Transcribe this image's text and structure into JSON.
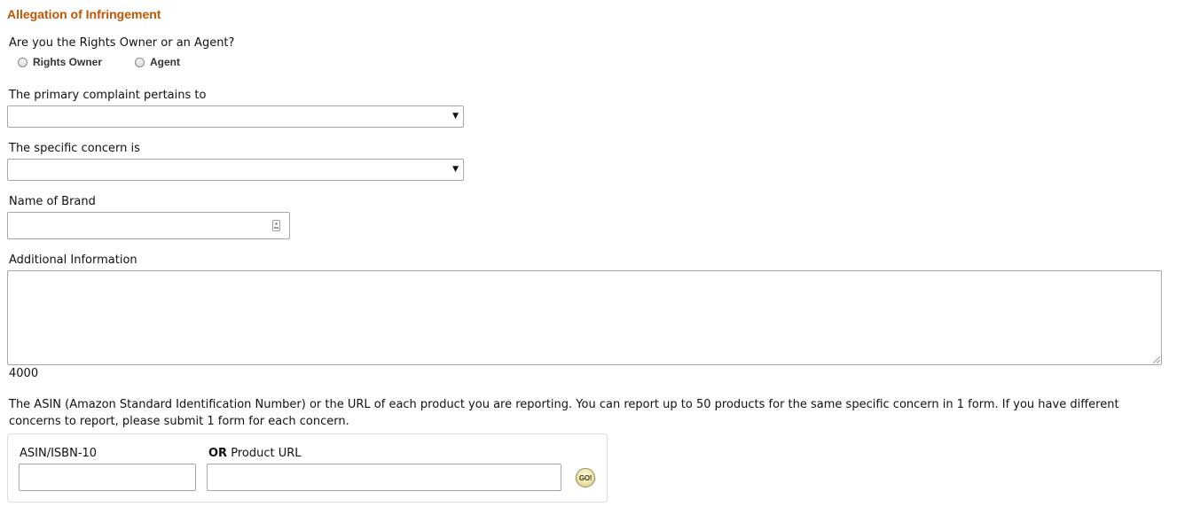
{
  "section": {
    "title": "Allegation of Infringement"
  },
  "role": {
    "question": "Are you the Rights Owner or an Agent?",
    "options": [
      {
        "label": "Rights Owner",
        "selected": false
      },
      {
        "label": "Agent",
        "selected": false
      }
    ]
  },
  "primary_complaint": {
    "label": "The primary complaint pertains to",
    "value": ""
  },
  "specific_concern": {
    "label": "The specific concern is",
    "value": ""
  },
  "brand": {
    "label": "Name of Brand",
    "value": ""
  },
  "additional_info": {
    "label": "Additional Information",
    "value": "",
    "remaining_chars": "4000"
  },
  "products": {
    "instructions": "The ASIN (Amazon Standard Identification Number) or the URL of each product you are reporting. You can report up to 50 products for the same specific concern in 1 form. If you have different concerns to report, please submit 1 form for each concern.",
    "asin_label": "ASIN/ISBN-10",
    "url_label_prefix": "OR",
    "url_label": "Product URL",
    "asin_value": "",
    "url_value": "",
    "go_label": "GO!"
  },
  "colors": {
    "title": "#c45500",
    "border": "#a6a6a6"
  },
  "icons": {
    "select_caret": "caret-down-icon",
    "brand_input": "contact-card-icon",
    "go": "go-button-icon"
  }
}
